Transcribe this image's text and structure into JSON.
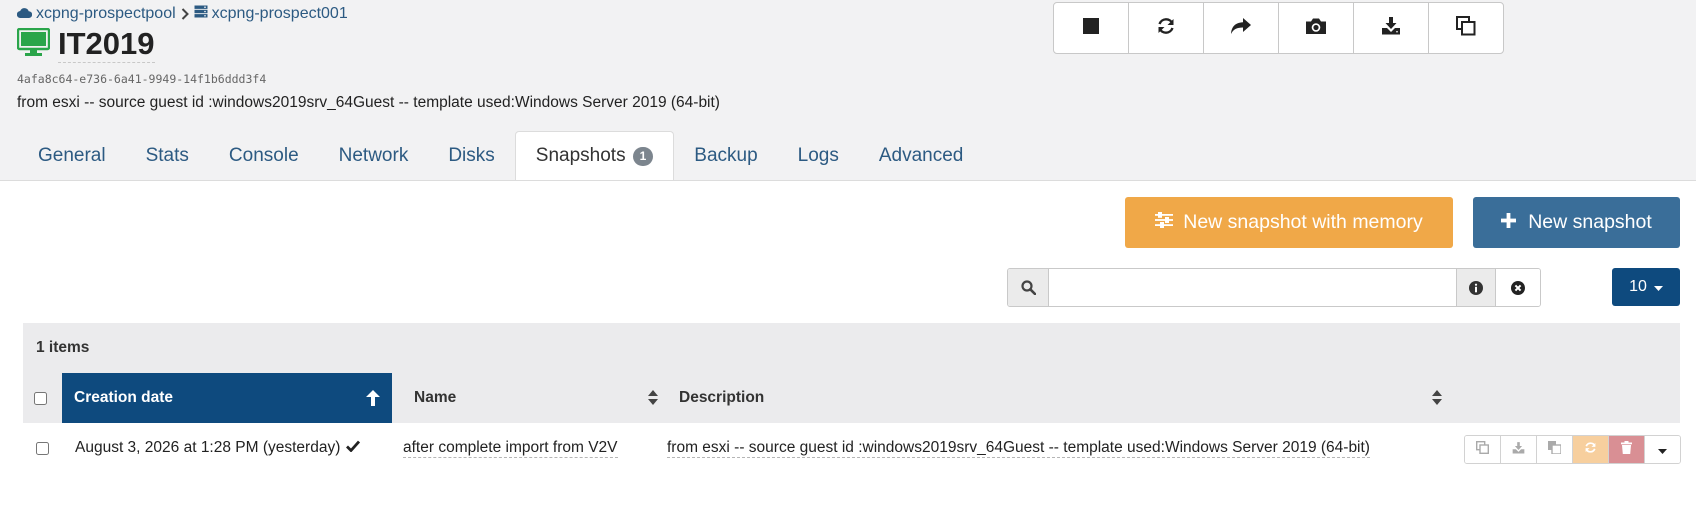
{
  "breadcrumb": {
    "pool": "xcpng-prospectpool",
    "host": "xcpng-prospect001"
  },
  "vm": {
    "name": "IT2019",
    "uuid": "4afa8c64-e736-6a41-9949-14f1b6ddd3f4",
    "description": "from esxi -- source guest id :windows2019srv_64Guest -- template used:Windows Server 2019 (64-bit)"
  },
  "tabs": [
    {
      "label": "General"
    },
    {
      "label": "Stats"
    },
    {
      "label": "Console"
    },
    {
      "label": "Network"
    },
    {
      "label": "Disks"
    },
    {
      "label": "Snapshots",
      "badge": "1",
      "active": true
    },
    {
      "label": "Backup"
    },
    {
      "label": "Logs"
    },
    {
      "label": "Advanced"
    }
  ],
  "buttons": {
    "memory": "New snapshot with memory",
    "new": "New snapshot"
  },
  "search": {
    "value": "",
    "placeholder": ""
  },
  "page_size": "10",
  "table": {
    "items_count": "1 items",
    "columns": {
      "date": "Creation date",
      "name": "Name",
      "description": "Description"
    },
    "rows": [
      {
        "date": "August 3, 2026 at 1:28 PM (yesterday)",
        "name": "after complete import from V2V",
        "description": "from esxi -- source guest id :windows2019srv_64Guest -- template used:Windows Server 2019 (64-bit)"
      }
    ]
  },
  "colors": {
    "accent": "#0e4a7e",
    "warning": "#f0a848",
    "primary": "#3a6e99",
    "running": "#2aa54a"
  }
}
